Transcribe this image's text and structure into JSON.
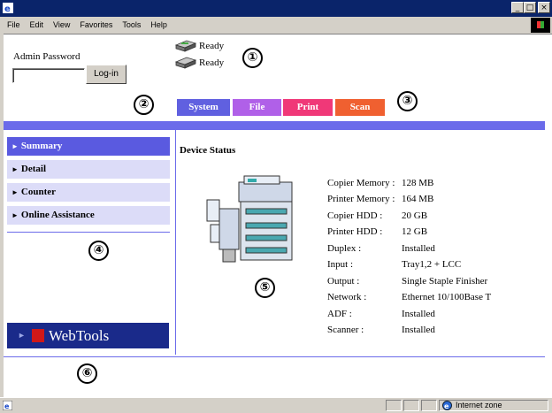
{
  "window": {
    "minimize": "_",
    "maximize": "□",
    "close": "×"
  },
  "menu": [
    "File",
    "Edit",
    "View",
    "Favorites",
    "Tools",
    "Help"
  ],
  "status": {
    "printer1": "Ready",
    "printer2": "Ready"
  },
  "callouts": [
    "①",
    "②",
    "③",
    "④",
    "⑤",
    "⑥"
  ],
  "login": {
    "label": "Admin Password",
    "password_value": "",
    "button": "Log-in"
  },
  "tabs": [
    {
      "label": "System",
      "color": "#6060e0"
    },
    {
      "label": "File",
      "color": "#b060e8"
    },
    {
      "label": "Print",
      "color": "#f03878"
    },
    {
      "label": "Scan",
      "color": "#f06030"
    }
  ],
  "nav": {
    "arrow": "►",
    "items": [
      "Summary",
      "Detail",
      "Counter",
      "Online Assistance"
    ]
  },
  "webtools": {
    "arrow": "►",
    "label": "WebTools"
  },
  "device": {
    "title": "Device Status",
    "specs": [
      {
        "label": "Copier Memory :",
        "value": "128 MB"
      },
      {
        "label": "Printer Memory :",
        "value": "164 MB"
      },
      {
        "label": "Copier HDD :",
        "value": "20 GB"
      },
      {
        "label": "Printer HDD :",
        "value": "12 GB"
      },
      {
        "label": "Duplex :",
        "value": "Installed"
      },
      {
        "label": "Input :",
        "value": "Tray1,2 + LCC"
      },
      {
        "label": "Output :",
        "value": "Single Staple Finisher"
      },
      {
        "label": "Network :",
        "value": "Ethernet 10/100Base T"
      },
      {
        "label": "ADF :",
        "value": "Installed"
      },
      {
        "label": "Scanner :",
        "value": "Installed"
      }
    ]
  },
  "statusbar": {
    "zone": "Internet zone"
  },
  "colors": {
    "accent": "#6b6bea",
    "nav_active": "#5a5ae0",
    "nav_inactive": "#dcdcf8",
    "webtools_bg": "#1a2a8a"
  }
}
